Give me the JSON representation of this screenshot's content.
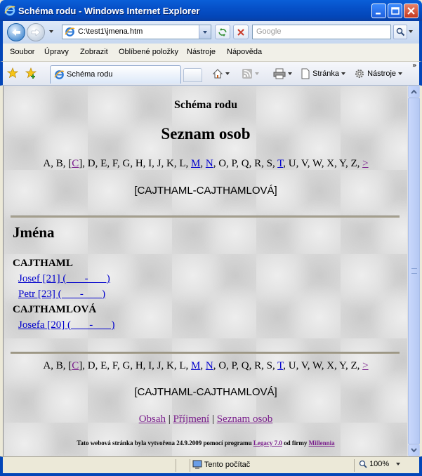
{
  "window": {
    "title": "Schéma rodu - Windows Internet Explorer"
  },
  "address_bar": {
    "url": "C:\\test1\\jmena.htm",
    "search_placeholder": "Google"
  },
  "menu": [
    "Soubor",
    "Úpravy",
    "Zobrazit",
    "Oblíbené položky",
    "Nástroje",
    "Nápověda"
  ],
  "tab": {
    "label": "Schéma rodu"
  },
  "toolbar": {
    "page_label": "Stránka",
    "tools_label": "Nástroje"
  },
  "page": {
    "site_title": "Schéma rodu",
    "list_heading": "Seznam osob",
    "alphabet": [
      {
        "l": "A",
        "link": false
      },
      {
        "l": "B",
        "link": false
      },
      {
        "l": "C",
        "link": true,
        "brackets": true,
        "visited": true
      },
      {
        "l": "D",
        "link": false
      },
      {
        "l": "E",
        "link": false
      },
      {
        "l": "F",
        "link": false
      },
      {
        "l": "G",
        "link": false
      },
      {
        "l": "H",
        "link": false
      },
      {
        "l": "I",
        "link": false
      },
      {
        "l": "J",
        "link": false
      },
      {
        "l": "K",
        "link": false
      },
      {
        "l": "L",
        "link": false
      },
      {
        "l": "M",
        "link": true
      },
      {
        "l": "N",
        "link": true
      },
      {
        "l": "O",
        "link": false
      },
      {
        "l": "P",
        "link": false
      },
      {
        "l": "Q",
        "link": false
      },
      {
        "l": "R",
        "link": false
      },
      {
        "l": "S",
        "link": false
      },
      {
        "l": "T",
        "link": true
      },
      {
        "l": "U",
        "link": false
      },
      {
        "l": "V",
        "link": false
      },
      {
        "l": "W",
        "link": false
      },
      {
        "l": "X",
        "link": false
      },
      {
        "l": "Y",
        "link": false
      },
      {
        "l": "Z",
        "link": false
      }
    ],
    "alphabet_next": ">",
    "range": "[CAJTHAML-CAJTHAMLOVÁ]",
    "names_heading": "Jména",
    "groups": [
      {
        "surname": "CAJTHAML",
        "persons": [
          "Josef [21] (       -       )",
          "Petr [23] (       -       )"
        ]
      },
      {
        "surname": "CAJTHAMLOVÁ",
        "persons": [
          "Josefa [20] (       -       )"
        ]
      }
    ],
    "footer_nav": [
      "Obsah",
      "Příjmení",
      "Seznam osob"
    ],
    "credit_prefix": "Tato webová stránka byla vytvořena 24.9.2009 pomocí programu ",
    "credit_program": "Legacy 7.0",
    "credit_middle": " od firmy ",
    "credit_company": "Millennia"
  },
  "status": {
    "zone": "Tento počítač",
    "zoom": "100%"
  }
}
